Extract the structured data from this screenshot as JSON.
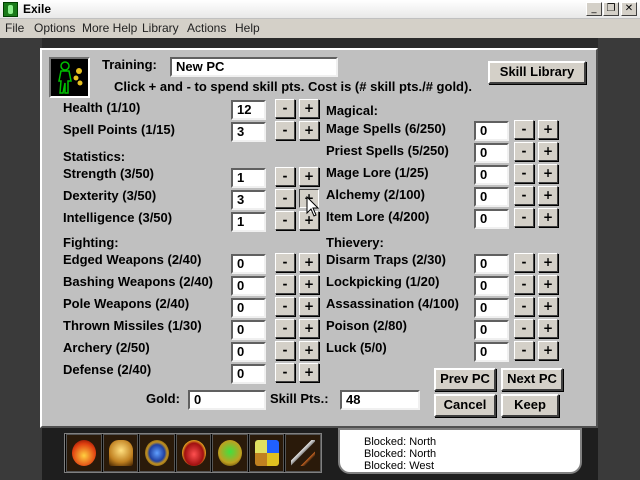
{
  "window": {
    "title": "Exile"
  },
  "menu": [
    "File",
    "Options",
    "More Help",
    "Library",
    "Actions",
    "Help"
  ],
  "dialog": {
    "training_label": "Training:",
    "pc_name": "New PC",
    "instructions": "Click + and - to spend skill pts. Cost is (# skill pts./# gold).",
    "skill_library_button": "Skill Library",
    "health": {
      "label": "Health (1/10)",
      "value": "12"
    },
    "spell_points": {
      "label": "Spell Points (1/15)",
      "value": "3"
    },
    "statistics": {
      "header": "Statistics:",
      "items": [
        {
          "label": "Strength (3/50)",
          "value": "1"
        },
        {
          "label": "Dexterity (3/50)",
          "value": "3"
        },
        {
          "label": "Intelligence (3/50)",
          "value": "1"
        }
      ]
    },
    "fighting": {
      "header": "Fighting:",
      "items": [
        {
          "label": "Edged Weapons (2/40)",
          "value": "0"
        },
        {
          "label": "Bashing Weapons (2/40)",
          "value": "0"
        },
        {
          "label": "Pole Weapons (2/40)",
          "value": "0"
        },
        {
          "label": "Thrown Missiles (1/30)",
          "value": "0"
        },
        {
          "label": "Archery (2/50)",
          "value": "0"
        },
        {
          "label": "Defense (2/40)",
          "value": "0"
        }
      ]
    },
    "magical": {
      "header": "Magical:",
      "items": [
        {
          "label": "Mage Spells (6/250)",
          "value": "0"
        },
        {
          "label": "Priest Spells (5/250)",
          "value": "0"
        },
        {
          "label": "Mage Lore (1/25)",
          "value": "0"
        },
        {
          "label": "Alchemy (2/100)",
          "value": "0"
        },
        {
          "label": "Item Lore (4/200)",
          "value": "0"
        }
      ]
    },
    "thievery": {
      "header": "Thievery:",
      "items": [
        {
          "label": "Disarm Traps (2/30)",
          "value": "0"
        },
        {
          "label": "Lockpicking (1/20)",
          "value": "0"
        },
        {
          "label": "Assassination (4/100)",
          "value": "0"
        },
        {
          "label": "Poison (2/80)",
          "value": "0"
        },
        {
          "label": "Luck (5/0)",
          "value": "0"
        }
      ]
    },
    "gold": {
      "label": "Gold:",
      "value": "0"
    },
    "skill_pts": {
      "label": "Skill Pts.:",
      "value": "48"
    },
    "minus_label": "-",
    "plus_label": "+",
    "prev_pc_button": "Prev PC",
    "next_pc_button": "Next PC",
    "cancel_button": "Cancel",
    "keep_button": "Keep"
  },
  "message_log": [
    "Blocked: North",
    "Blocked: North",
    "Blocked: West"
  ],
  "colors": {
    "dialog_bg": "#c0c0c0",
    "game_bg": "#1e1e1e"
  }
}
